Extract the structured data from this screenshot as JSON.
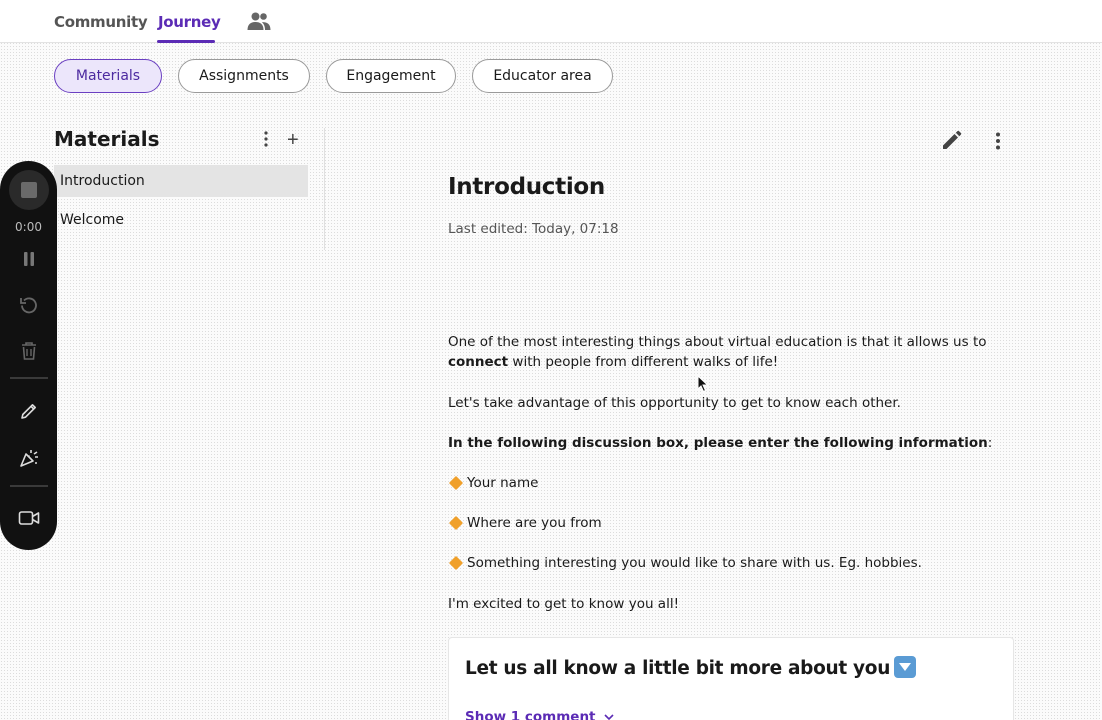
{
  "topnav": {
    "tabs": [
      "Community",
      "Journey"
    ],
    "active_tab": "Journey",
    "people_icon": "people-icon"
  },
  "pills": [
    {
      "label": "Materials",
      "active": true
    },
    {
      "label": "Assignments",
      "active": false
    },
    {
      "label": "Engagement",
      "active": false
    },
    {
      "label": "Educator area",
      "active": false
    }
  ],
  "sidebar": {
    "title": "Materials",
    "plus": "+",
    "items": [
      {
        "label": "Introduction",
        "selected": true
      },
      {
        "label": "Welcome",
        "selected": false
      }
    ]
  },
  "recorder": {
    "time": "0:00",
    "icons": [
      "stop-icon",
      "pause-icon",
      "restart-icon",
      "trash-icon",
      "pencil-icon",
      "effects-icon",
      "camera-icon"
    ]
  },
  "main": {
    "title": "Introduction",
    "last_edited": "Last edited: Today, 07:18",
    "para1_a": "One of the most interesting things about virtual education is that it allows us to",
    "para1_bold": "connect",
    "para1_b": " with people from different walks of life!",
    "para2": "Let's take advantage of this opportunity to get to know each other.",
    "para3_bold": "In the following discussion box, please enter the following information",
    "para3_tail": ":",
    "bullets": [
      "Your name",
      "Where are you from",
      "Something interesting you would like to share with us. Eg. hobbies."
    ],
    "para_end": "I'm excited to get to know you all!",
    "card": {
      "title": "Let us all know a little bit more about you",
      "show_comment": "Show 1 comment"
    }
  },
  "colors": {
    "accent": "#5b2bb5",
    "pill_active_bg": "#ece6fb",
    "recorder_bg": "#111111",
    "bullet": "#f0a02a"
  }
}
